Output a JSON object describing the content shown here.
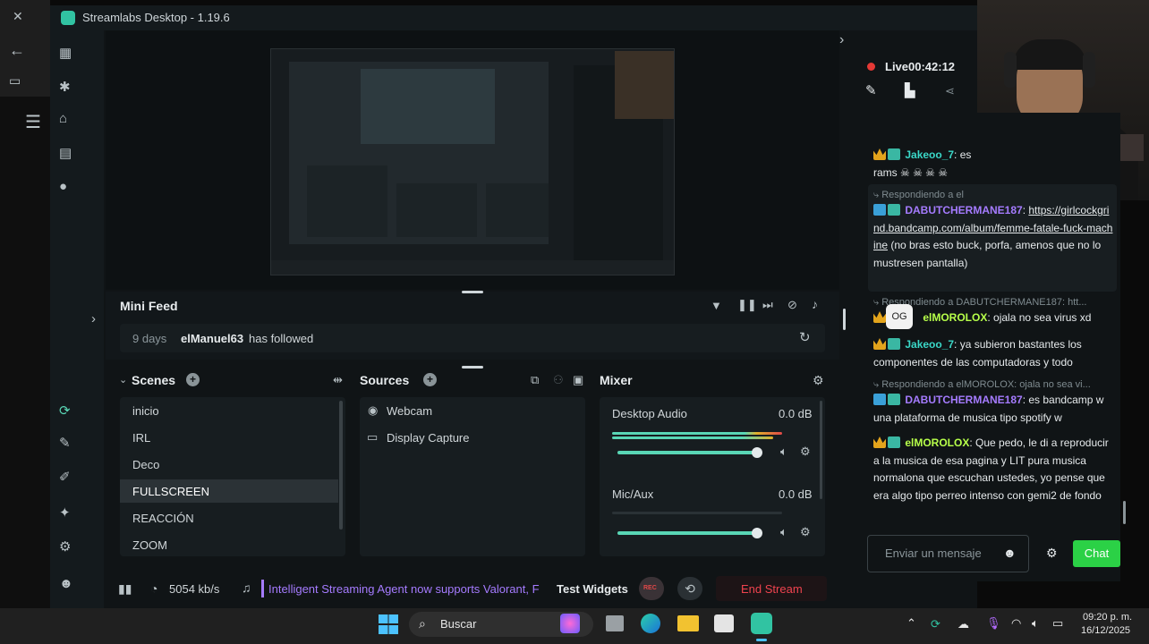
{
  "app": {
    "title": "Streamlabs Desktop - 1.19.6"
  },
  "stream": {
    "live_label": "Live",
    "timer": "00:42:12",
    "bitrate": "5054 kb/s"
  },
  "minifeed": {
    "title": "Mini Feed",
    "event": {
      "time": "9 days",
      "user": "elManuel63",
      "action": "has followed"
    }
  },
  "scenes": {
    "title": "Scenes",
    "items": [
      "inicio",
      "IRL",
      "Deco",
      "FULLSCREEN",
      "REACCIÓN",
      "ZOOM"
    ],
    "selected": "FULLSCREEN"
  },
  "sources": {
    "title": "Sources",
    "items": [
      "Webcam",
      "Display Capture"
    ]
  },
  "mixer": {
    "title": "Mixer",
    "channels": [
      {
        "name": "Desktop Audio",
        "db": "0.0 dB",
        "volume": 0.85
      },
      {
        "name": "Mic/Aux",
        "db": "0.0 dB",
        "volume": 0.85
      }
    ]
  },
  "footer": {
    "ticker": "Intelligent Streaming Agent now supports Valorant, F",
    "test_widgets": "Test Widgets",
    "rec": "REC",
    "end_stream": "End Stream"
  },
  "chat": {
    "partial_top": {
      "user": "Jakeoo_7",
      "text": "es",
      "line2": "rams ☠ ☠ ☠ ☠"
    },
    "messages": [
      {
        "reply": "Respondiendo a el",
        "user": "DABUTCHERMANE187",
        "user_color": "#a57bff",
        "link": "https://girlcockgrind.bandcamp.com/album/femme-fatale-fuck-machine",
        "text": " (no bras esto buck, porfa, amenos que no lo mustresen pantalla)"
      },
      {
        "reply": "Respondiendo a DABUTCHERMANE187: htt...",
        "user": "elMOROLOX",
        "user_color": "#b7ff4a",
        "text": "ojala no sea virus xd",
        "tooltip": "OG"
      },
      {
        "user": "Jakeoo_7",
        "user_color": "#3ad8c8",
        "text": "ya subieron bastantes los componentes de las computadoras y todo"
      },
      {
        "reply": "Respondiendo a elMOROLOX: ojala no sea vi...",
        "user": "DABUTCHERMANE187",
        "user_color": "#a57bff",
        "text": "es bandcamp w una plataforma de musica tipo spotify w"
      },
      {
        "user": "elMOROLOX",
        "user_color": "#b7ff4a",
        "text": "Que pedo, le di a reproducir a la musica de esa pagina y LIT pura musica normalona que escuchan ustedes, yo pense que era algo tipo perreo intenso con gemi2 de fondo"
      }
    ],
    "input_placeholder": "Enviar un mensaje",
    "send_label": "Chat"
  },
  "taskbar": {
    "search_placeholder": "Buscar",
    "time": "09:20 p. m.",
    "date": "16/12/2025"
  },
  "colors": {
    "accent": "#31c3a2",
    "chat_button": "#2bd146",
    "end_stream": "#f0434f",
    "live_dot": "#e53935"
  }
}
